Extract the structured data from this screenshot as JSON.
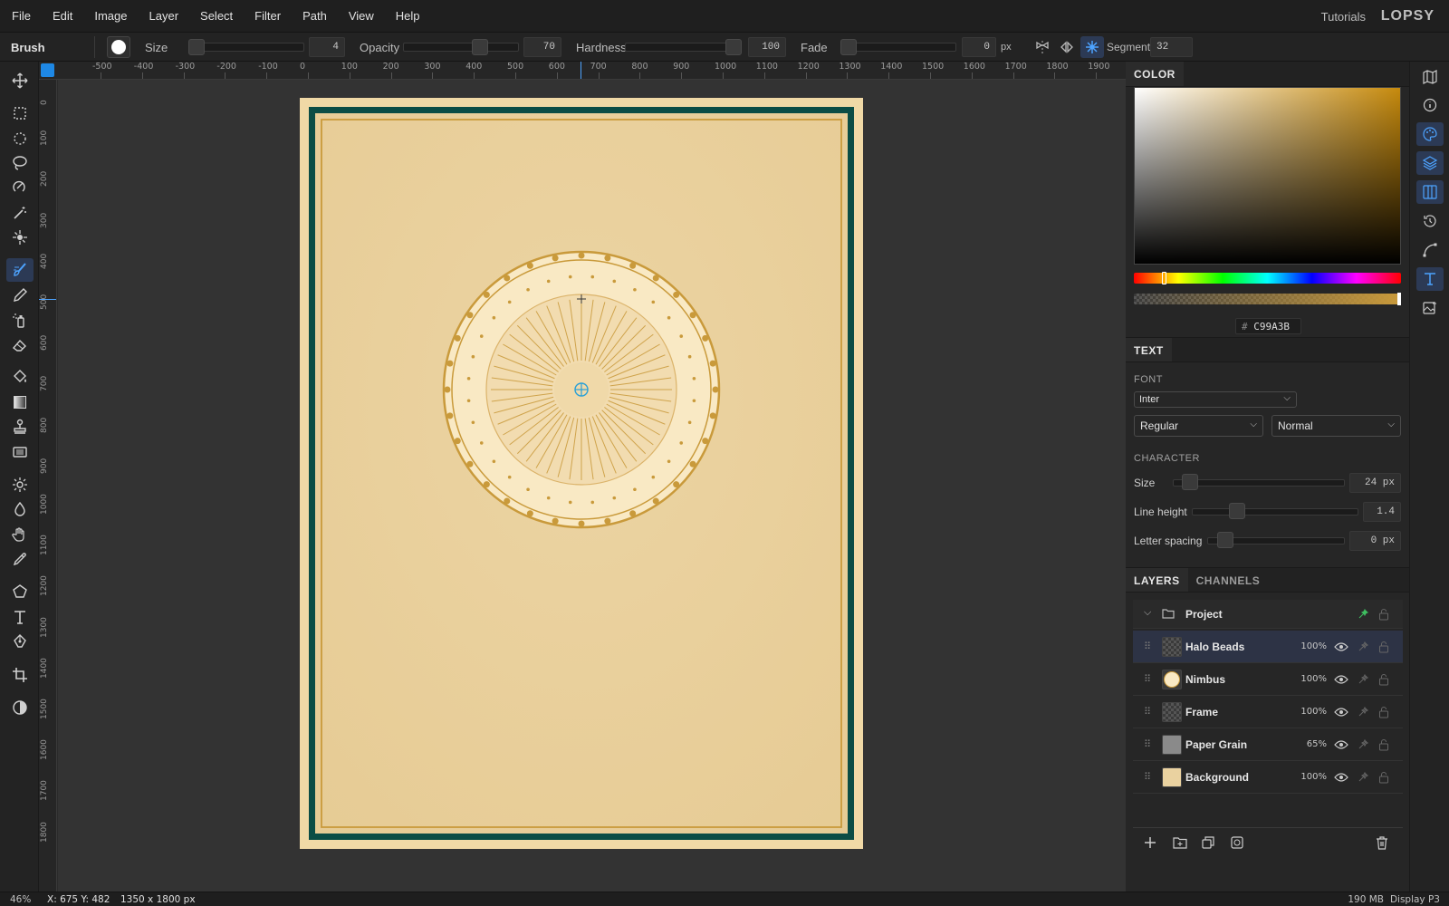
{
  "menu": [
    "File",
    "Edit",
    "Image",
    "Layer",
    "Select",
    "Filter",
    "Path",
    "View",
    "Help"
  ],
  "header": {
    "tutorials": "Tutorials",
    "brand": "LOPSY"
  },
  "options": {
    "tool": "Brush",
    "size_label": "Size",
    "size_value": "4",
    "opacity_label": "Opacity",
    "opacity_value": "70",
    "hardness_label": "Hardness",
    "hardness_value": "100",
    "fade_label": "Fade",
    "fade_value": "0",
    "fade_unit": "px",
    "segments_label": "Segments",
    "segments_value": "32"
  },
  "ruler": {
    "top": [
      "-500",
      "-400",
      "-300",
      "-200",
      "-100",
      "0",
      "100",
      "200",
      "300",
      "400",
      "500",
      "600",
      "700",
      "800",
      "900",
      "1000",
      "1100",
      "1200",
      "1300",
      "1400",
      "1500",
      "1600",
      "1700",
      "1800",
      "1900"
    ],
    "left": [
      "0",
      "100",
      "200",
      "300",
      "400",
      "500",
      "600",
      "700",
      "800",
      "900",
      "1000",
      "1100",
      "1200",
      "1300",
      "1400",
      "1500",
      "1600",
      "1700",
      "1800"
    ]
  },
  "color_panel": {
    "title": "COLOR",
    "hex_prefix": "#",
    "hex": "C99A3B",
    "accent": "#c99a3b"
  },
  "text_panel": {
    "title": "TEXT",
    "font_label": "FONT",
    "font": "Inter",
    "weight": "Regular",
    "style": "Normal",
    "character_label": "CHARACTER",
    "size_label": "Size",
    "size_value": "24 px",
    "line_height_label": "Line height",
    "line_height_value": "1.4",
    "letter_spacing_label": "Letter spacing",
    "letter_spacing_value": "0 px"
  },
  "layers_panel": {
    "tabs": [
      "LAYERS",
      "CHANNELS"
    ],
    "group": "Project",
    "layers": [
      {
        "name": "Halo Beads",
        "opacity": "100%"
      },
      {
        "name": "Nimbus",
        "opacity": "100%"
      },
      {
        "name": "Frame",
        "opacity": "100%"
      },
      {
        "name": "Paper Grain",
        "opacity": "65%"
      },
      {
        "name": "Background",
        "opacity": "100%"
      }
    ]
  },
  "status": {
    "zoom": "46%",
    "coords": "X: 675 Y: 482",
    "dims": "1350 x 1800 px",
    "memory": "190 MB",
    "profile": "Display P3"
  },
  "artwork": {
    "paper": "#ead2a0",
    "frame": "#0b4d45",
    "gold": "#c99a3b",
    "nimbus": "#f9e9c4"
  }
}
